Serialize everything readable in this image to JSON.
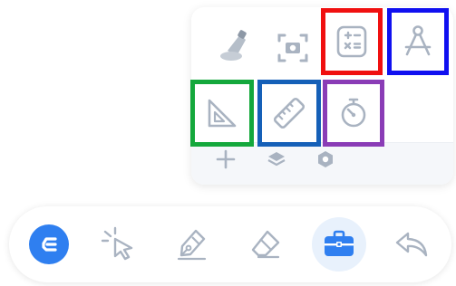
{
  "tool_panel": {
    "row1": [
      {
        "name": "spotlight-icon"
      },
      {
        "name": "screenshot-icon"
      },
      {
        "name": "calculator-icon",
        "highlight": "#f01010"
      },
      {
        "name": "compass-icon",
        "highlight": "#1010f0"
      }
    ],
    "row2": [
      {
        "name": "set-square-icon",
        "highlight": "#14a83c"
      },
      {
        "name": "ruler-icon",
        "highlight": "#1560b8"
      },
      {
        "name": "stopwatch-icon",
        "highlight": "#8a3cb6"
      }
    ],
    "footer": [
      {
        "name": "add-icon"
      },
      {
        "name": "layers-icon"
      },
      {
        "name": "settings-hex-icon"
      }
    ]
  },
  "dock": {
    "items": [
      {
        "name": "app-logo-icon"
      },
      {
        "name": "select-pointer-icon"
      },
      {
        "name": "pen-icon"
      },
      {
        "name": "eraser-icon"
      },
      {
        "name": "toolbox-icon",
        "active": true
      },
      {
        "name": "undo-icon"
      }
    ]
  },
  "colors": {
    "accent": "#2f7ff0",
    "icon_gray": "#a9b3c1",
    "active_bg": "#e8f1fc"
  }
}
